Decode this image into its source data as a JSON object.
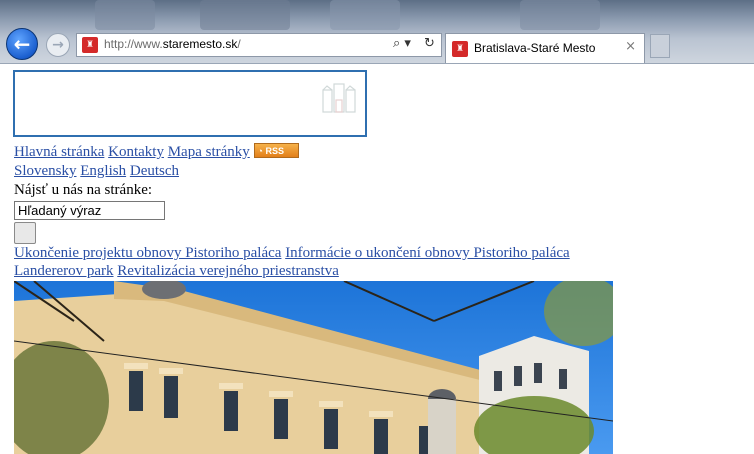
{
  "browser": {
    "url_prefix": "http://www.",
    "url_domain": "staremesto.sk",
    "url_suffix": "/",
    "search_icon": "⌕ ▾",
    "refresh_icon": "↻",
    "tab_title": "Bratislava-Staré Mesto",
    "tab_close": "×",
    "back_icon": "←",
    "forward_icon": "→",
    "favicon_icon": "castle-icon"
  },
  "header": {
    "links": [
      "Hlavná stránka",
      "Kontakty",
      "Mapa stránky"
    ],
    "rss_label": "RSS"
  },
  "languages": [
    "Slovensky",
    "English",
    "Deutsch"
  ],
  "search": {
    "label": "Nájsť u nás na stránke:",
    "value": "Hľadaný výraz"
  },
  "news": {
    "line1": [
      "Ukončenie projektu obnovy Pistoriho paláca",
      "Informácie o ukončení obnovy Pistoriho paláca"
    ],
    "line2": [
      "Landererov park",
      "Revitalizácia verejného priestranstva"
    ]
  },
  "colors": {
    "link": "#2a4fa5",
    "logo_border": "#2f6fb0",
    "ie_blue": "#1b5fcf",
    "favicon_red": "#d42a2a"
  }
}
